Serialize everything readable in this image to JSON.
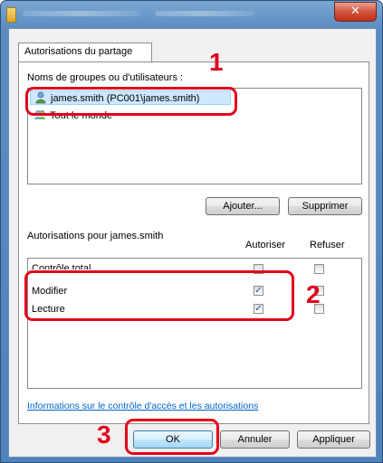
{
  "dialog": {
    "close_symbol": "✕"
  },
  "tab": {
    "label": "Autorisations du partage"
  },
  "groups": {
    "label": "Noms de groupes ou d'utilisateurs :",
    "items": [
      {
        "name": "james.smith (PC001\\james.smith)",
        "icon": "user-icon"
      },
      {
        "name": "Tout le monde",
        "icon": "group-icon"
      }
    ],
    "add_button": "Ajouter...",
    "remove_button": "Supprimer"
  },
  "permissions": {
    "label": "Autorisations pour james.smith",
    "col_allow": "Autoriser",
    "col_deny": "Refuser",
    "rows": [
      {
        "name": "Contrôle total",
        "allow": false,
        "deny": false
      },
      {
        "name": "Modifier",
        "allow": true,
        "deny": false
      },
      {
        "name": "Lecture",
        "allow": true,
        "deny": false
      }
    ]
  },
  "link": {
    "text": "Informations sur le contrôle d'accès et les autorisations"
  },
  "footer": {
    "ok": "OK",
    "cancel": "Annuler",
    "apply": "Appliquer"
  },
  "annotations": {
    "step1": "1",
    "step2": "2",
    "step3": "3",
    "color": "#e3001b"
  }
}
